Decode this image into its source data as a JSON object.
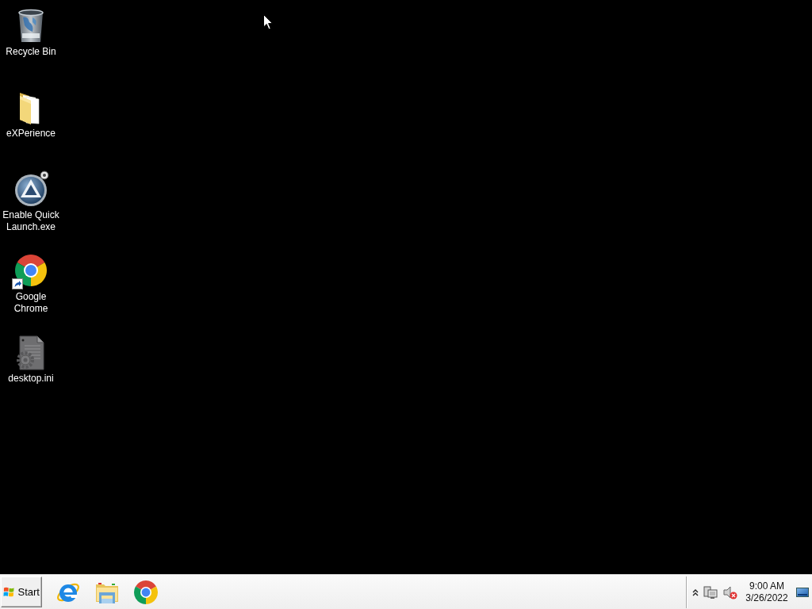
{
  "desktop": {
    "icons": [
      {
        "label": "Recycle Bin",
        "kind": "recycle-bin",
        "shortcut": false
      },
      {
        "label": "eXPerience",
        "kind": "folder",
        "shortcut": false
      },
      {
        "label": "Enable Quick Launch.exe",
        "kind": "app",
        "shortcut": false
      },
      {
        "label": "Google Chrome",
        "kind": "chrome",
        "shortcut": true
      },
      {
        "label": "desktop.ini",
        "kind": "settings-file",
        "shortcut": false
      }
    ]
  },
  "taskbar": {
    "start_button": {
      "label": "Start"
    },
    "pinned": [
      {
        "kind": "ie"
      },
      {
        "kind": "explorer"
      },
      {
        "kind": "chrome"
      }
    ],
    "tray": {
      "volume": {
        "muted": true
      },
      "clock": {
        "time": "9:00 AM",
        "date": "3/26/2022"
      }
    }
  }
}
